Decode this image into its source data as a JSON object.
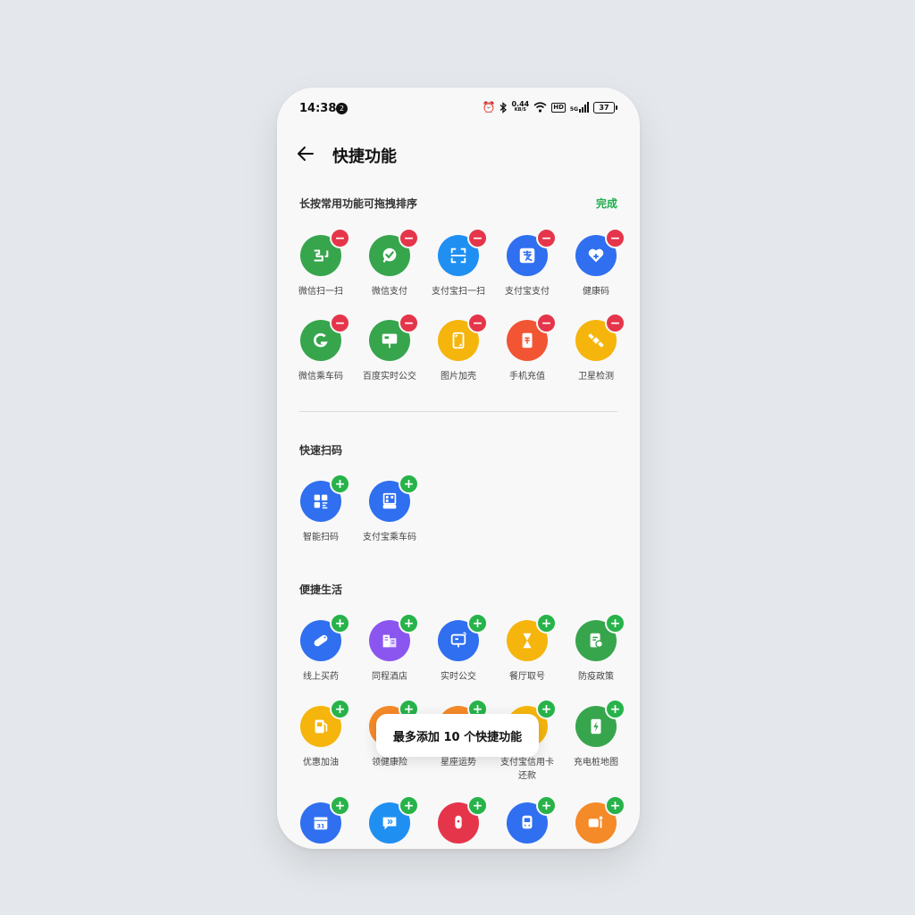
{
  "status_bar": {
    "time": "14:38",
    "notification_count": "2",
    "net_speed": "0.44",
    "net_unit": "KB/S",
    "hd": "HD",
    "signal_type": "5G",
    "battery": "37"
  },
  "header": {
    "title": "快捷功能"
  },
  "sections": {
    "added": {
      "title": "长按常用功能可拖拽排序",
      "done_label": "完成"
    },
    "scan": {
      "title": "快速扫码"
    },
    "life": {
      "title": "便捷生活"
    }
  },
  "colors": {
    "green": "#37a54c",
    "blue": "#2f6ff0",
    "blue_light": "#1f8ff2",
    "yellow": "#f5b50c",
    "red_orange": "#f25533",
    "purple": "#8b56f0",
    "badge_remove": "#e5354a",
    "badge_add": "#27b34a",
    "accent_done": "#1fad4c"
  },
  "added_items": [
    {
      "label": "微信扫一扫",
      "icon": "wechat-scan-icon"
    },
    {
      "label": "微信支付",
      "icon": "wechat-pay-icon"
    },
    {
      "label": "支付宝扫一扫",
      "icon": "alipay-scan-icon"
    },
    {
      "label": "支付宝支付",
      "icon": "alipay-pay-icon"
    },
    {
      "label": "健康码",
      "icon": "health-code-icon"
    },
    {
      "label": "微信乘车码",
      "icon": "wechat-bus-code-icon"
    },
    {
      "label": "百度实时公交",
      "icon": "baidu-bus-icon"
    },
    {
      "label": "图片加壳",
      "icon": "image-frame-icon"
    },
    {
      "label": "手机充值",
      "icon": "phone-recharge-icon"
    },
    {
      "label": "卫星检测",
      "icon": "satellite-icon"
    }
  ],
  "scan_items": [
    {
      "label": "智能扫码",
      "icon": "smart-scan-icon"
    },
    {
      "label": "支付宝乘车码",
      "icon": "alipay-bus-code-icon"
    }
  ],
  "life_items": [
    {
      "label": "线上买药",
      "icon": "pill-icon"
    },
    {
      "label": "同程酒店",
      "icon": "hotel-icon"
    },
    {
      "label": "实时公交",
      "icon": "bus-realtime-icon"
    },
    {
      "label": "餐厅取号",
      "icon": "restaurant-queue-icon"
    },
    {
      "label": "防疫政策",
      "icon": "epidemic-policy-icon"
    },
    {
      "label": "优惠加油",
      "icon": "fuel-icon"
    },
    {
      "label": "领健康险",
      "icon": "health-insurance-icon"
    },
    {
      "label": "星座运势",
      "icon": "horoscope-icon"
    },
    {
      "label": "支付宝信用卡\n还款",
      "icon": "credit-card-icon"
    },
    {
      "label": "充电桩地图",
      "icon": "charging-icon"
    },
    {
      "label": "",
      "icon": "calendar-icon"
    },
    {
      "label": "",
      "icon": "message-icon"
    },
    {
      "label": "",
      "icon": "mic-icon"
    },
    {
      "label": "",
      "icon": "metro-icon"
    },
    {
      "label": "",
      "icon": "shuttle-icon"
    }
  ],
  "calendar_day": "31",
  "toast": "最多添加 10 个快捷功能"
}
